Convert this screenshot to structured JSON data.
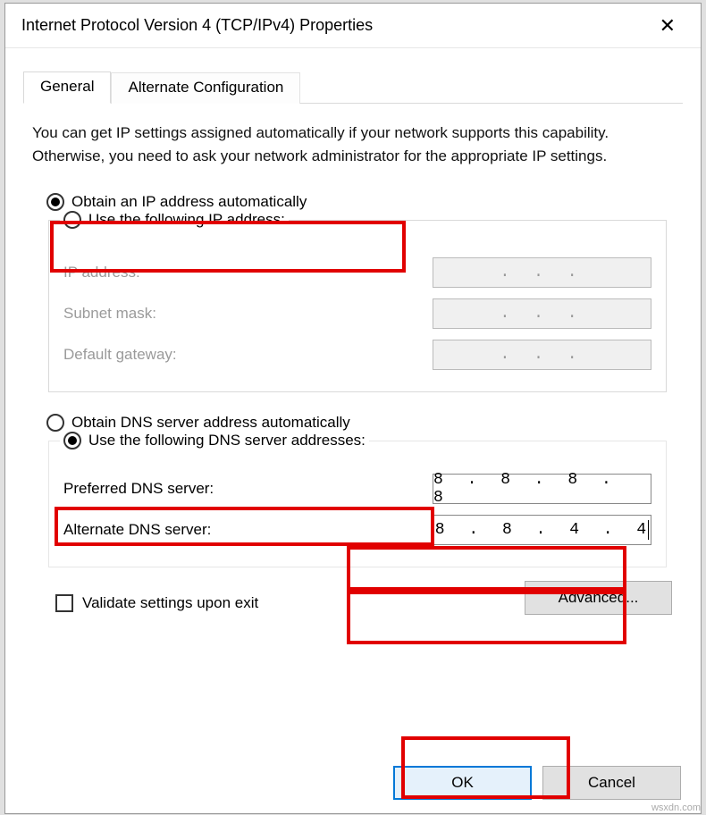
{
  "window": {
    "title": "Internet Protocol Version 4 (TCP/IPv4) Properties"
  },
  "tabs": {
    "general": "General",
    "alternate": "Alternate Configuration"
  },
  "description": "You can get IP settings assigned automatically if your network supports this capability. Otherwise, you need to ask your network administrator for the appropriate IP settings.",
  "ip_section": {
    "auto_label": "Obtain an IP address automatically",
    "manual_label": "Use the following IP address:",
    "ip_address_label": "IP address:",
    "subnet_label": "Subnet mask:",
    "gateway_label": "Default gateway:",
    "ip_address_value": ".   .   .",
    "subnet_value": ".   .   .",
    "gateway_value": ".   .   ."
  },
  "dns_section": {
    "auto_label": "Obtain DNS server address automatically",
    "manual_label": "Use the following DNS server addresses:",
    "preferred_label": "Preferred DNS server:",
    "alternate_label": "Alternate DNS server:",
    "preferred_value": "8 . 8 . 8 . 8",
    "alternate_value": "8 . 8 . 4 . 4"
  },
  "validate_label": "Validate settings upon exit",
  "buttons": {
    "advanced": "Advanced...",
    "ok": "OK",
    "cancel": "Cancel"
  },
  "watermark": "wsxdn.com"
}
